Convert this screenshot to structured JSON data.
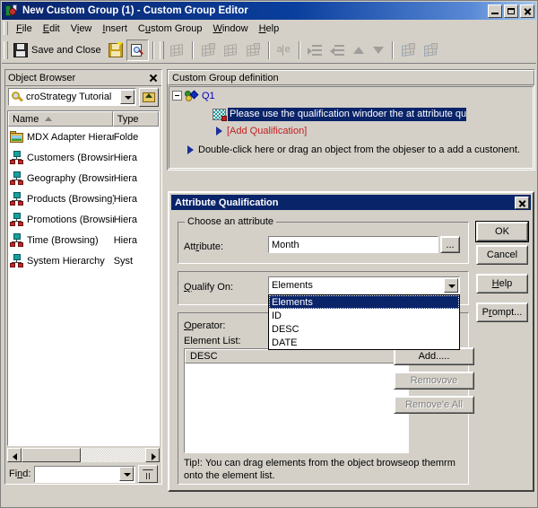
{
  "window": {
    "title": "New Custom Group (1) - Custom Group Editor",
    "icon": "custom-group-editor-icon",
    "minimize_label": "Minimize",
    "maximize_label": "Maximize",
    "close_label": "Close"
  },
  "menubar": {
    "items": [
      {
        "label": "File",
        "accel": "F"
      },
      {
        "label": "Edit",
        "accel": "E"
      },
      {
        "label": "View",
        "accel": "V"
      },
      {
        "label": "Insert",
        "accel": "I"
      },
      {
        "label": "Custom Group",
        "accel": "u"
      },
      {
        "label": "Window",
        "accel": "W"
      },
      {
        "label": "Help",
        "accel": "H"
      }
    ]
  },
  "toolbar": {
    "save_and_close_label": "Save and Close",
    "buttons": [
      {
        "name": "save-and-close-button",
        "icon": "floppy-disk-icon",
        "label": "Save and Close",
        "enabled": true
      },
      {
        "name": "save-button",
        "icon": "floppy-disk-new-icon",
        "label": "Save",
        "enabled": true
      },
      {
        "name": "view-sql-button",
        "icon": "search-page-icon",
        "label": "View SQL",
        "enabled": true,
        "pressed": true
      },
      {
        "name": "new-element-button",
        "icon": "grid-icon",
        "label": "New",
        "enabled": false
      },
      {
        "name": "cut-button",
        "icon": "grid-cut-icon",
        "label": "Cut",
        "enabled": false
      },
      {
        "name": "copy-button",
        "icon": "grid-copy-icon",
        "label": "Copy",
        "enabled": false
      },
      {
        "name": "paste-button",
        "icon": "grid-paste-icon",
        "label": "Paste",
        "enabled": false
      },
      {
        "name": "rename-button",
        "icon": "ae-text-icon",
        "label": "Rename",
        "enabled": false
      },
      {
        "name": "indent-button",
        "icon": "indent-icon",
        "label": "Indent",
        "enabled": false
      },
      {
        "name": "outdent-button",
        "icon": "outdent-icon",
        "label": "Outdent",
        "enabled": false
      },
      {
        "name": "move-up-button",
        "icon": "arrow-up-icon",
        "label": "Move Up",
        "enabled": false
      },
      {
        "name": "move-down-button",
        "icon": "arrow-down-icon",
        "label": "Move Down",
        "enabled": false
      },
      {
        "name": "banding-button",
        "icon": "grid-banding-icon",
        "label": "Banding",
        "enabled": true
      },
      {
        "name": "options-button",
        "icon": "grid-options-icon",
        "label": "Options",
        "enabled": true
      }
    ]
  },
  "object_browser": {
    "title": "Object Browser",
    "close_label": "Close",
    "source": {
      "value": "croStrategy Tutorial",
      "icon": "magnifier-icon",
      "arrow": "chevron-down-icon"
    },
    "up_button_label": "Up One Level",
    "columns": [
      {
        "label": "Name",
        "sort": "ascending"
      },
      {
        "label": "Type"
      }
    ],
    "rows": [
      {
        "name": "MDX Adapter Hierarchies",
        "type": "Folde",
        "icon": "folder-icon"
      },
      {
        "name": "Customers (Browsing)",
        "type": "Hiera",
        "icon": "hierarchy-icon"
      },
      {
        "name": "Geography (Browsing)",
        "type": "Hiera",
        "icon": "hierarchy-icon"
      },
      {
        "name": "Products (Browsing)",
        "type": "Hiera",
        "icon": "hierarchy-icon"
      },
      {
        "name": "Promotions (Browsing)",
        "type": "Hiera",
        "icon": "hierarchy-icon"
      },
      {
        "name": "Time (Browsing)",
        "type": "Hiera",
        "icon": "hierarchy-icon"
      },
      {
        "name": "System Hierarchy",
        "type": "Syst",
        "icon": "hierarchy-icon"
      }
    ],
    "find": {
      "label": "Find:",
      "value": "",
      "placeholder": "",
      "arrow": "chevron-down-icon",
      "filter_button_label": "Filter"
    },
    "hscroll": {
      "left_label": "Scroll Left",
      "right_label": "Scroll Right"
    }
  },
  "custom_group_definition": {
    "header": "Custom Group definition",
    "tree": {
      "expander": "collapse-toggle",
      "root_label": "Q1",
      "root_icon": "custom-group-node-icon",
      "selected_item": {
        "icon": "qualification-icon",
        "text": "Please use the qualification windoer the at attribute qua"
      },
      "add_qualification_label": "[Add Qualification]",
      "hint": "Double-click here or drag an object from the objeser to a add a custonent."
    }
  },
  "attribute_qualification_dialog": {
    "title": "Attribute Qualification",
    "close_label": "Close",
    "choose_attribute": {
      "legend": "Choose an attribute",
      "attribute_label": "Attribute:",
      "attribute_value": "Month",
      "browse_button_label": "..."
    },
    "qualify_on": {
      "label": "Qualify On:",
      "selected": "Elements",
      "arrow": "chevron-down-icon",
      "options": [
        "Elements",
        "ID",
        "DESC",
        "DATE"
      ]
    },
    "operator_label": "Operator:",
    "element_list_label": "Element List:",
    "element_list_header": "DESC",
    "element_list_items": [],
    "list_buttons": [
      {
        "name": "add-button",
        "label": "Add.....",
        "enabled": true
      },
      {
        "name": "remove-button",
        "label": "Removove",
        "enabled": false
      },
      {
        "name": "remove-all-button",
        "label": "Remove'e All",
        "enabled": false
      }
    ],
    "tip": "Tip!:  You can drag elements from the object browseop themrm onto the element list.",
    "action_buttons": [
      {
        "name": "ok-button",
        "label": "OK",
        "default": true
      },
      {
        "name": "cancel-button",
        "label": "Cancel",
        "default": false
      },
      {
        "name": "help-button",
        "label": "Help",
        "default": false
      },
      {
        "name": "prompt-button",
        "label": "Prompt...",
        "default": false
      }
    ]
  },
  "colors": {
    "titlebar_start": "#0a246a",
    "face": "#d4d0c8",
    "selection": "#0a246a",
    "link_red": "#c02020",
    "node_blue": "#0000c0"
  }
}
